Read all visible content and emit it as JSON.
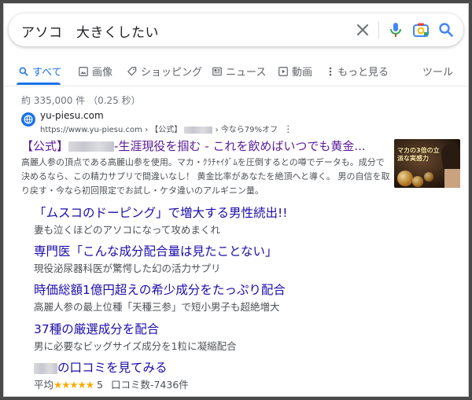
{
  "search": {
    "query": "アソコ　大きくしたい"
  },
  "tabs": [
    {
      "label": "すべて"
    },
    {
      "label": "画像"
    },
    {
      "label": "ショッピング"
    },
    {
      "label": "ニュース"
    },
    {
      "label": "動画"
    },
    {
      "label": "もっと見る"
    },
    {
      "label": "ツール"
    }
  ],
  "result_stats": "約 335,000 件 （0.25 秒）",
  "ad": {
    "site_name": "yu-piesu.com",
    "url": "https://www.yu-piesu.com",
    "breadcrumb_sep": "›",
    "breadcrumb_official": "【公式】",
    "offer": "今なら79%オフ",
    "more_label": "⋮",
    "title_prefix": "【公式】",
    "title_suffix": "-生涯現役を掴む - これを飲めばいつでも黄金...",
    "description": "高麗人参の頂点である高麗山参を使用。マカ・ｸﾗﾁｬｲﾀﾞﾑを圧倒するとの噂でデータも。成分で決めるなら、この精力サプリで間違いなし！ 黄金比率があなたを絶頂へと導く。 男の自信を取り戻す・今なら初回限定でお試し・ケタ違いのアルギニン量。",
    "thumbnail_text": "マカの3倍の立派な実感力"
  },
  "sitelinks": [
    {
      "title": "「ムスコのドーピング」で増大する男性続出!!",
      "desc": "妻も泣くほどのアソコになって攻めまくれ"
    },
    {
      "title": "専門医「こんな成分配合量は見たことない」",
      "desc": "現役泌尿器科医が驚愕した幻の活力サプリ"
    },
    {
      "title": "時価総額1億円超えの希少成分をたっぷり配合",
      "desc": "高麗人参の最上位種「天種三参」で短小男子も超絶増大"
    },
    {
      "title": "37種の厳選成分を配合",
      "desc": "男に必要なビッグサイズ成分を1粒に凝縮配合"
    }
  ],
  "review": {
    "title_suffix": "の口コミを見てみる",
    "rating_label": "平均",
    "stars": "★★★★★",
    "rating_value": "5",
    "count_label": "口コミ数-7436件"
  },
  "colors": {
    "link": "#1a0dab",
    "visited": "#5a1d9a",
    "accent": "#1a73e8",
    "star": "#f9ab00"
  }
}
